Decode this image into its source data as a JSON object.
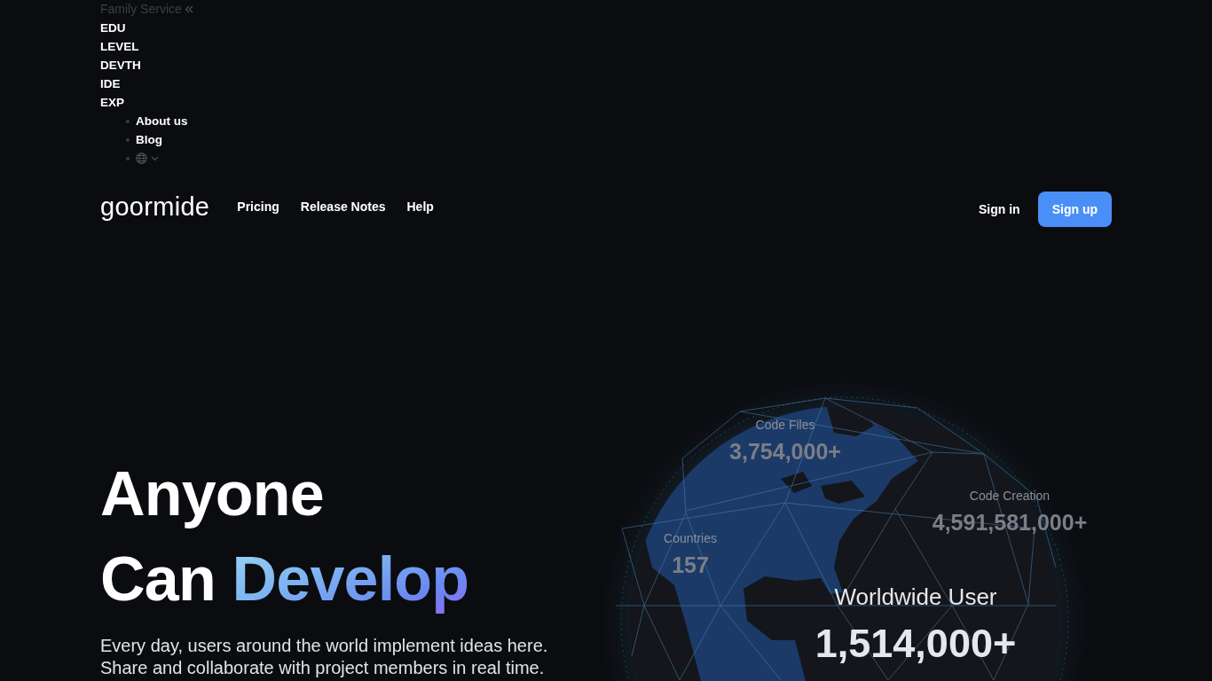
{
  "family_menu": {
    "label": "Family Service",
    "items": [
      "EDU",
      "LEVEL",
      "DEVTH",
      "IDE",
      "EXP"
    ]
  },
  "links": [
    {
      "kind": "link",
      "label": "About us"
    },
    {
      "kind": "link",
      "label": "Blog"
    },
    {
      "kind": "language"
    }
  ],
  "nav": {
    "logo": "**goorm**ide",
    "items": [
      "Pricing",
      "Release Notes",
      "Help"
    ],
    "sign_in": "Sign in",
    "sign_up": "Sign up"
  },
  "hero": {
    "title": [
      "Anyone",
      "Can *Develop*"
    ],
    "description": "Every day, users around the world implement ideas here. Share and collaborate with project members in real time."
  },
  "stats": [
    {
      "label": "Code Files",
      "value": "3,754,000+",
      "kind": "faded"
    },
    {
      "label": "Code Creation",
      "value": "4,591,581,000+",
      "kind": "faded"
    },
    {
      "label": "Countries",
      "value": "157",
      "kind": "faded"
    },
    {
      "label": "Worldwide User",
      "value": "1,514,000+",
      "kind": "featured"
    }
  ]
}
